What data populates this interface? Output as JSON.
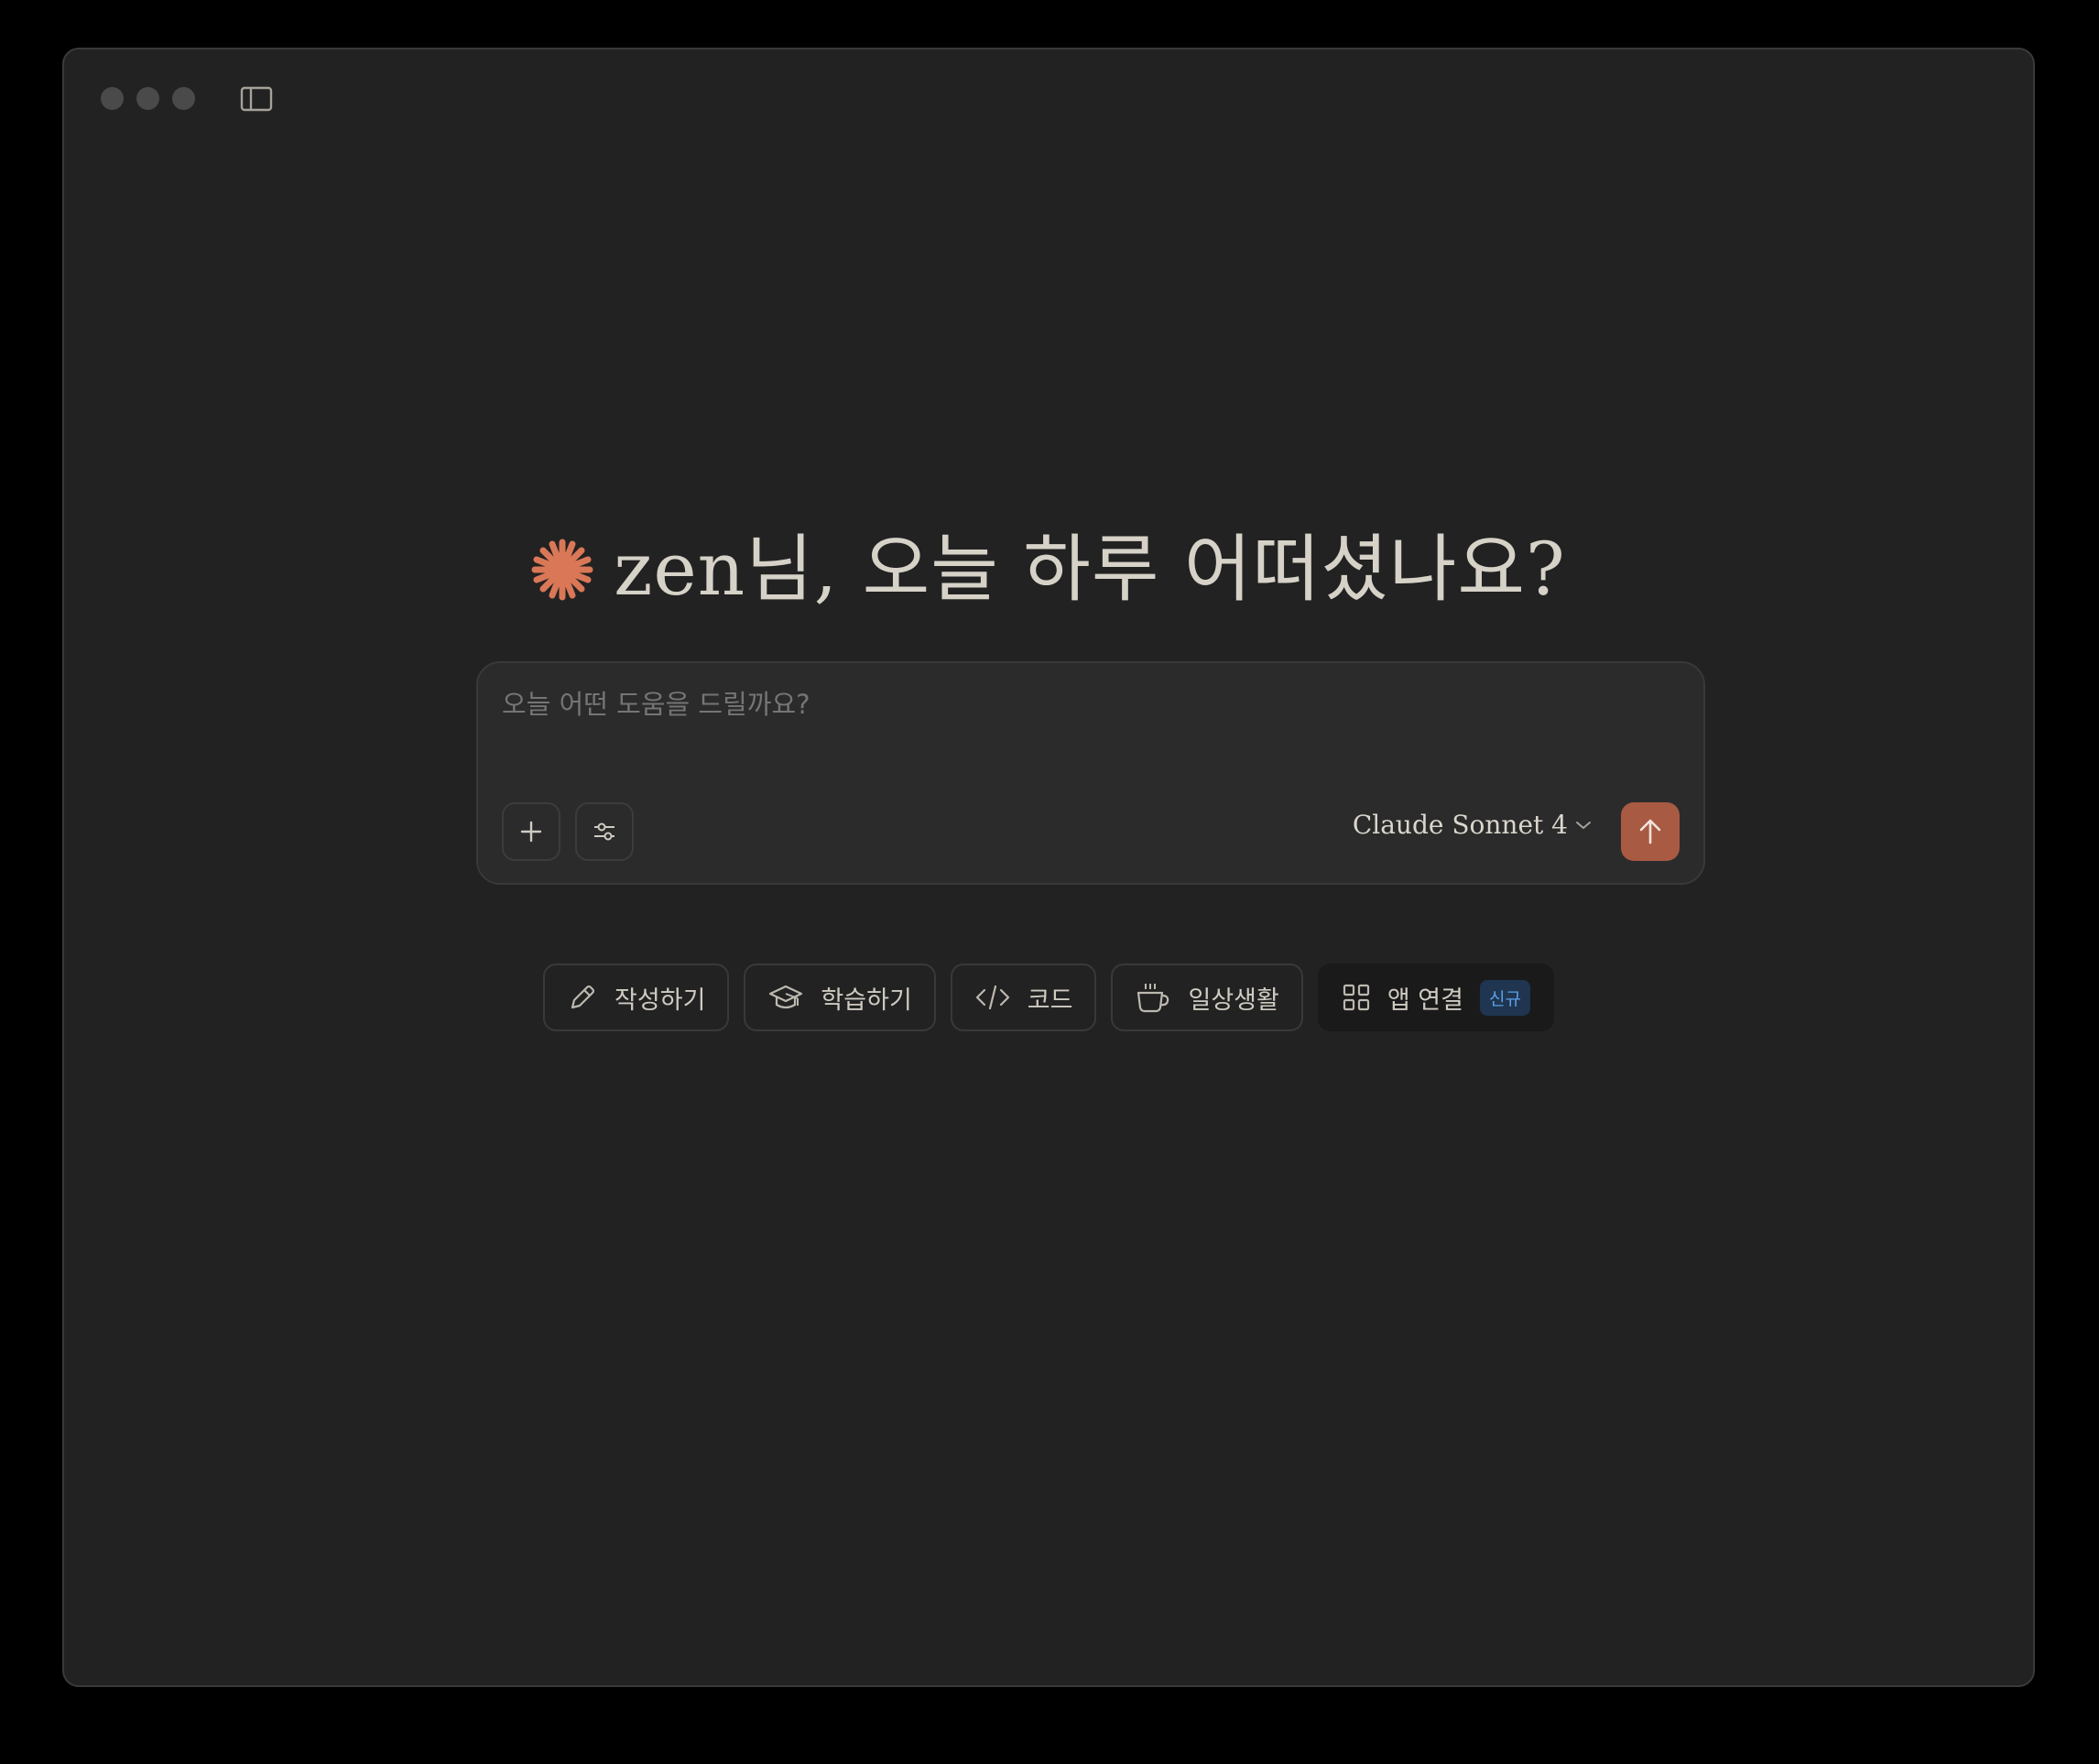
{
  "window": {
    "traffic_lights": [
      "close",
      "minimize",
      "zoom"
    ],
    "sidebar_toggle_icon": "sidebar-icon"
  },
  "greeting": {
    "logo_icon": "claude-starburst-icon",
    "logo_color": "#d97757",
    "text": "zen님, 오늘 하루 어떠셨나요?"
  },
  "composer": {
    "placeholder": "오늘 어떤 도움을 드릴까요?",
    "add_icon": "plus-icon",
    "tools_icon": "sliders-icon",
    "model_name": "Claude Sonnet 4",
    "model_dropdown_icon": "chevron-down-icon",
    "send_icon": "arrow-up-icon",
    "send_color": "#a85a43"
  },
  "chips": {
    "write": {
      "label": "작성하기",
      "icon": "pencil-icon"
    },
    "learn": {
      "label": "학습하기",
      "icon": "graduation-cap-icon"
    },
    "code": {
      "label": "코드",
      "icon": "code-icon"
    },
    "life": {
      "label": "일상생활",
      "icon": "coffee-cup-icon"
    },
    "apps": {
      "label": "앱 연결",
      "icon": "grid-icon",
      "badge": "신규"
    }
  }
}
